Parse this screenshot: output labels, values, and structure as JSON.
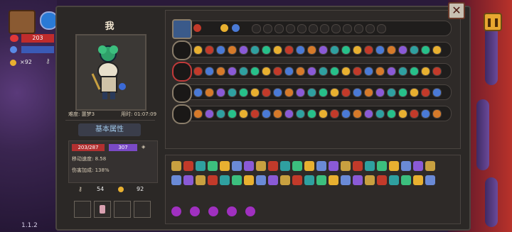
{
  "player": {
    "name": "我"
  },
  "info": {
    "difficulty": "难度: 噩梦3",
    "time": "用时: 01:07:09"
  },
  "attributes": {
    "button_label": "基本属性",
    "hp": "203/287",
    "shield": "307",
    "move_speed": "移动速度: 8.58",
    "damage_bonus": "伤害加成: 138%"
  },
  "currency": {
    "keys": "54",
    "coins": "92"
  },
  "hud": {
    "hp": "203",
    "coins": "×92"
  },
  "version": "1.1.2",
  "colors": {
    "accent_green": "#27c08a",
    "accent_gold": "#e8b030",
    "hp_red": "#d23a3a",
    "shield_purple": "#8a5ad6"
  }
}
